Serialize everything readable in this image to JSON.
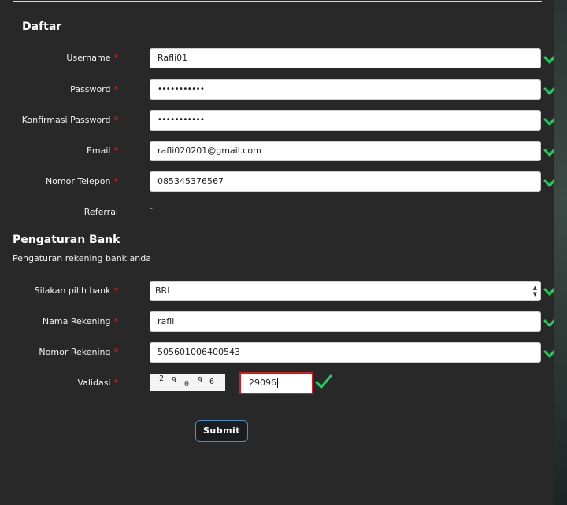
{
  "form": {
    "title": "Daftar",
    "required_mark": "*",
    "username": {
      "label": "Username",
      "value": "Rafli01"
    },
    "password": {
      "label": "Password",
      "value": "•••••••••••"
    },
    "confirm_password": {
      "label": "Konfirmasi Password",
      "value": "•••••••••••"
    },
    "email": {
      "label": "Email",
      "value": "rafli020201@gmail.com"
    },
    "phone": {
      "label": "Nomor Telepon",
      "value": "085345376567"
    },
    "referral": {
      "label": "Referral",
      "value": "-"
    }
  },
  "bank": {
    "title": "Pengaturan Bank",
    "subtitle": "Pengaturan rekening bank anda",
    "select_bank": {
      "label": "Silakan pilih bank",
      "value": "BRI"
    },
    "account_name": {
      "label": "Nama Rekening",
      "value": "rafli"
    },
    "account_number": {
      "label": "Nomor Rekening",
      "value": "505601006400543"
    },
    "validation": {
      "label": "Validasi",
      "captcha_digits": [
        "2",
        "9",
        "0",
        "9",
        "6"
      ],
      "value": "29096"
    }
  },
  "actions": {
    "submit_label": "Submit"
  },
  "colors": {
    "valid_check": "#1ecf5a",
    "required": "#e0202b",
    "captcha_error_border": "#d81a22",
    "submit_border": "#4a90c8"
  }
}
